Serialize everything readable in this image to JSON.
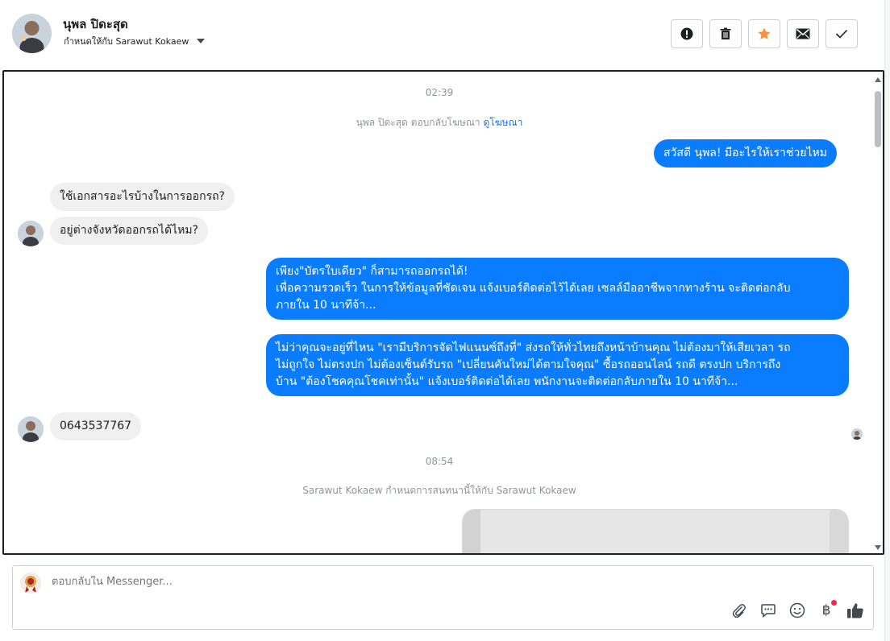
{
  "header": {
    "contact_name": "นุพล ปิดะสุด",
    "assigned_text": "กำหนดให้กับ Sarawut Kokaew",
    "actions": [
      {
        "icon": "alert-icon",
        "label": "Mark as spam"
      },
      {
        "icon": "trash-icon",
        "label": "Delete"
      },
      {
        "icon": "star-icon",
        "label": "Star"
      },
      {
        "icon": "envelope-icon",
        "label": "Mark as unread"
      },
      {
        "icon": "check-icon",
        "label": "Mark as done"
      }
    ],
    "star_color": "#f7923b"
  },
  "chat": {
    "timestamp_1": "02:39",
    "system_1_text": "นุพล ปิดะสุด ตอบกลับโฆษณา",
    "system_1_link": "ดูโฆษณา",
    "outgoing_1": "สวัสดี นุพล! มีอะไรให้เราช่วยไหม",
    "incoming_1": "ใช้เอกสารอะไรบ้างในการออกรถ?",
    "incoming_2": "อยู่ต่างจังหวัดออกรถได้ไหม?",
    "outgoing_2_lines": [
      "เพียง\"บัตรใบเดียว\" ก็สามารถออกรถได้!",
      "เพื่อความรวดเร็ว ในการให้ข้อมูลที่ชัดเจน แจ้งเบอร์ติดต่อไว้ได้เลย เซลล์มืออาชีพจากทางร้าน จะติดต่อกลับ",
      "ภายใน 10 นาทีจ้า..."
    ],
    "outgoing_3_lines": [
      "ไม่ว่าคุณจะอยู่ที่ไหน \"เรามีบริการจัดไฟแนนซ์ถึงที่\"  ส่งรถให้ทั่วไทยถึงหน้าบ้านคุณ ไม่ต้องมาให้เสียเวลา รถ",
      "ไม่ถูกใจ ไม่ตรงปก ไม่ต้องเซ็นต์รับรถ \"เปลี่ยนคันใหม่ได้ตามใจคุณ\" ซื้อรถออนไลน์ รถดี ตรงปก บริการถึง",
      "บ้าน \"ต้องโชคคุณโชคเท่านั้น\" แจ้งเบอร์ติดต่อได้เลย พนักงานจะติดต่อกลับภายใน 10 นาทีจ้า..."
    ],
    "incoming_3": "0643537767",
    "timestamp_2": "08:54",
    "system_2_text": "Sarawut Kokaew กำหนดการสนทนานี้ให้กับ Sarawut Kokaew",
    "outgoing_color": "#0a7cff",
    "incoming_color": "#f0f0f0"
  },
  "composer": {
    "placeholder": "ตอบกลับใน Messenger...",
    "tools": [
      "paperclip-icon",
      "saved-replies-icon",
      "emoji-icon",
      "payment-icon",
      "thumbs-up-icon"
    ],
    "payment_symbol": "฿",
    "like_color": "#444950"
  }
}
